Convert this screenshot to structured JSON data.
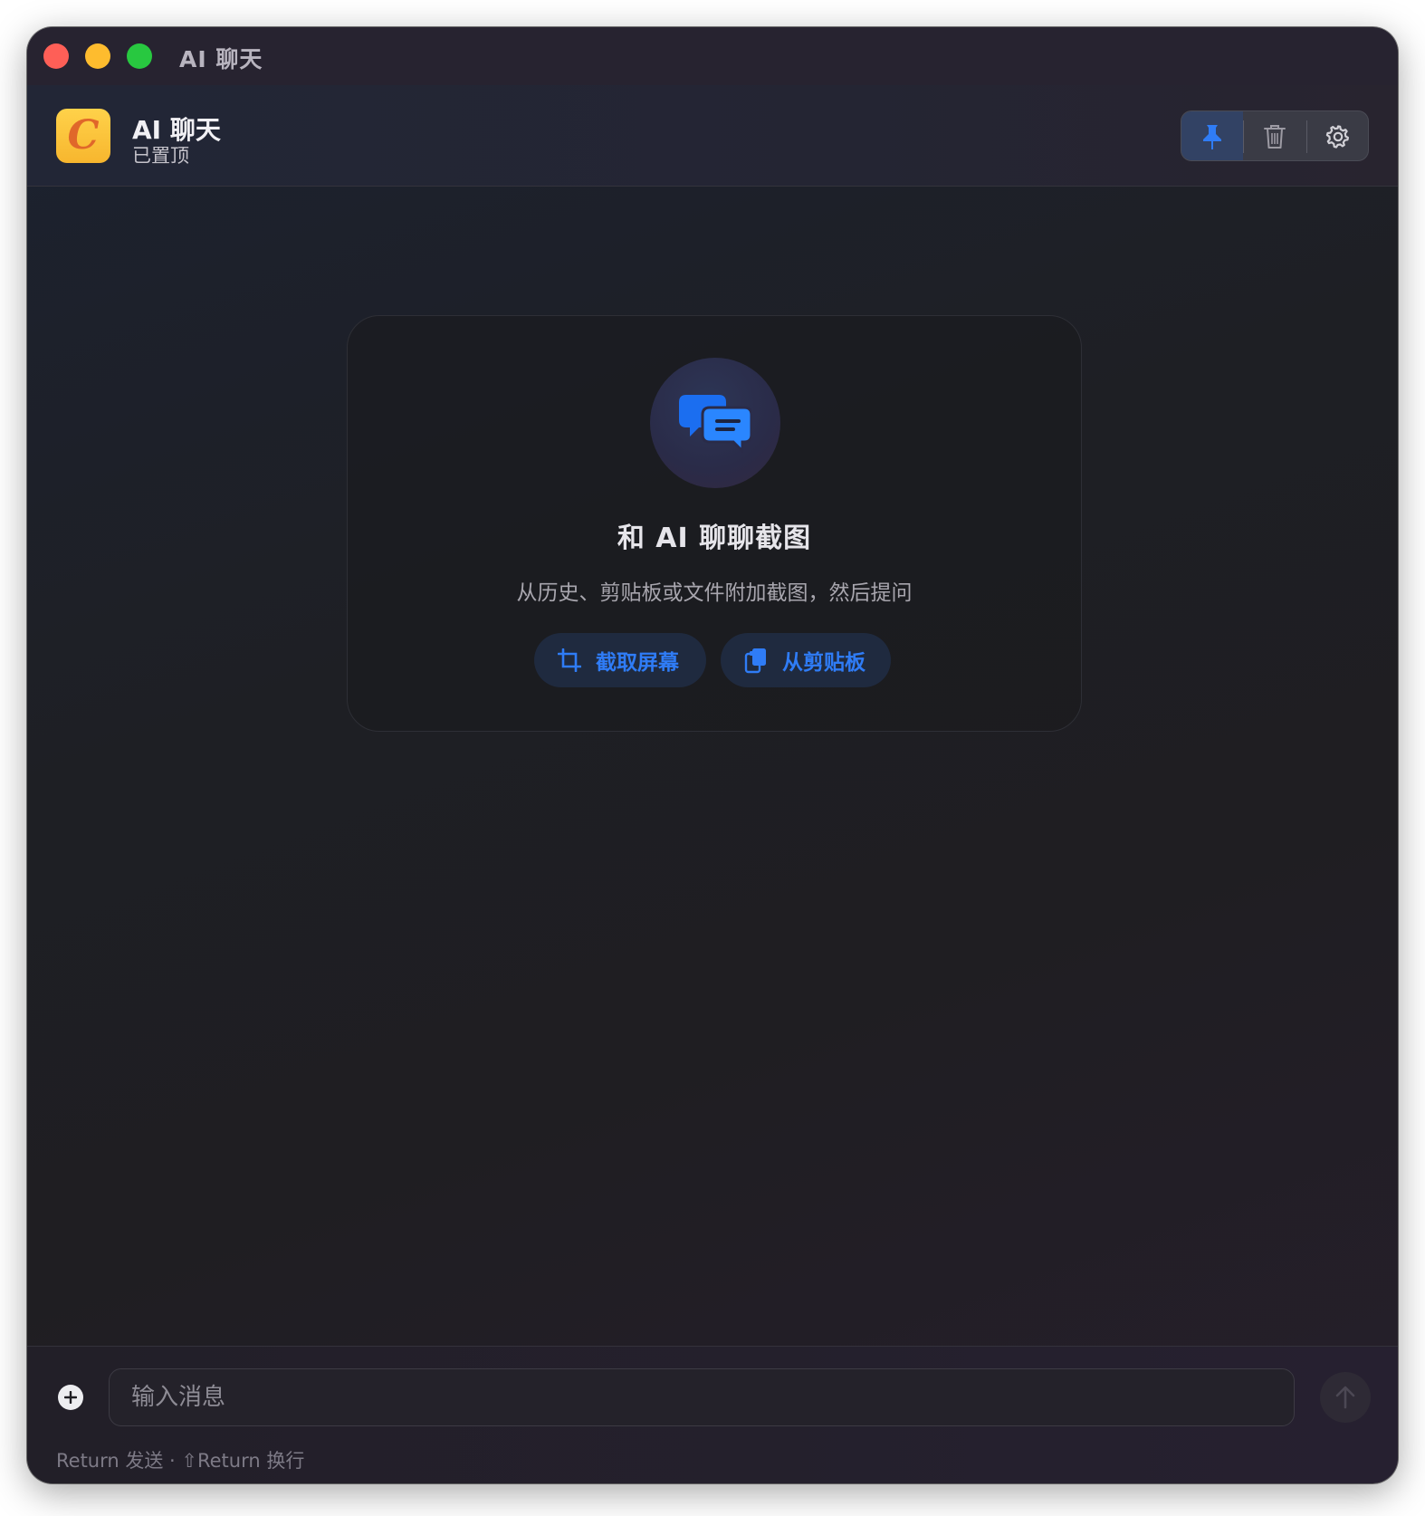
{
  "window": {
    "title": "AI 聊天"
  },
  "header": {
    "logo_letter": "C",
    "app_name": "AI 聊天",
    "status": "已置顶",
    "tools": [
      {
        "icon": "pin-icon",
        "active": true
      },
      {
        "icon": "trash-icon",
        "active": false
      },
      {
        "icon": "gear-icon",
        "active": false
      }
    ]
  },
  "welcome": {
    "icon": "chat-bubbles-icon",
    "title": "和 AI 聊聊截图",
    "subtitle": "从历史、剪贴板或文件附加截图，然后提问",
    "capture_label": "截取屏幕",
    "clipboard_label": "从剪贴板"
  },
  "composer": {
    "placeholder": "输入消息",
    "value": "",
    "hint": "Return 发送 · ⇧Return 换行"
  },
  "colors": {
    "accent": "#2f7cf6",
    "logo_bg": "#f7b62e",
    "logo_letter": "#e0672a",
    "traffic_close": "#fe5f57",
    "traffic_min": "#febc2e",
    "traffic_max": "#28c840"
  }
}
